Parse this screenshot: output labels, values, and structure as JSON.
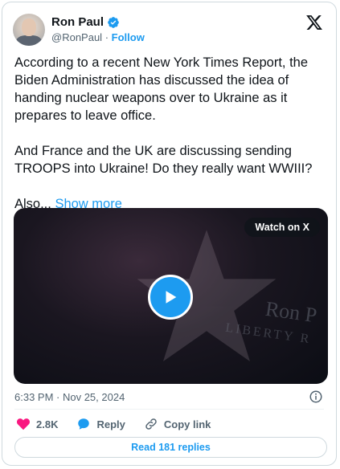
{
  "author": {
    "name": "Ron Paul",
    "handle": "@RonPaul",
    "separator": "·",
    "follow_label": "Follow"
  },
  "tweet": {
    "text": "According to a recent New York Times Report, the Biden Administration has discussed the idea of handing nuclear weapons over to Ukraine as it prepares to leave office.\n\nAnd France and the UK are discussing sending TROOPS into Ukraine! Do they really want WWIII?\n\nAlso... ",
    "show_more_label": "Show more",
    "timestamp": "6:33 PM · Nov 25, 2024"
  },
  "video": {
    "watch_label": "Watch on X"
  },
  "actions": {
    "like_count": "2.8K",
    "reply_label": "Reply",
    "copy_label": "Copy link",
    "read_replies_label": "Read 181 replies"
  },
  "colors": {
    "accent": "#1d9bf0",
    "like": "#f91880",
    "text": "#0f1419",
    "muted": "#536471"
  },
  "icons": [
    "verified-badge-icon",
    "x-logo-icon",
    "play-icon",
    "info-icon",
    "heart-icon",
    "reply-bubble-icon",
    "link-icon"
  ]
}
